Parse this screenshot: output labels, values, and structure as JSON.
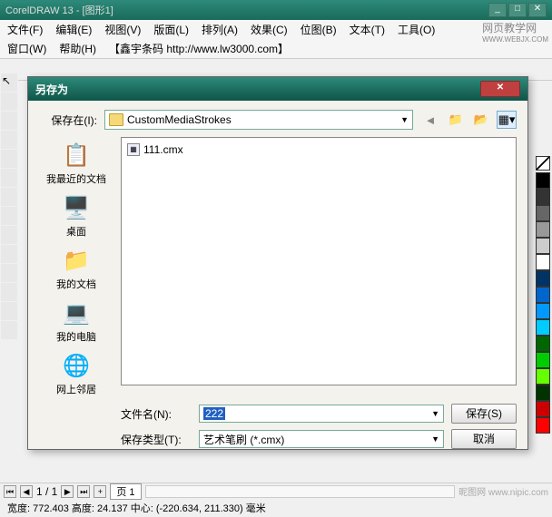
{
  "app": {
    "title": "CorelDRAW 13 - [图形1]",
    "watermark": "网页教学网",
    "watermark_url": "WWW.WEBJX.COM"
  },
  "menu": {
    "items": [
      "文件(F)",
      "编辑(E)",
      "视图(V)",
      "版面(L)",
      "排列(A)",
      "效果(C)",
      "位图(B)",
      "文本(T)",
      "工具(O)"
    ],
    "row2": [
      "窗口(W)",
      "帮助(H)"
    ],
    "extra": "【鑫宇条码 http://www.lw3000.com】"
  },
  "dialog": {
    "title": "另存为",
    "close_x": "✕",
    "save_in_label": "保存在(I):",
    "folder_name": "CustomMediaStrokes",
    "places": [
      {
        "icon": "📄",
        "label": "我最近的文档"
      },
      {
        "icon": "🖥️",
        "label": "桌面"
      },
      {
        "icon": "📁",
        "label": "我的文档"
      },
      {
        "icon": "💻",
        "label": "我的电脑"
      },
      {
        "icon": "🌐",
        "label": "网上邻居"
      }
    ],
    "file_item": "111.cmx",
    "filename_label": "文件名(N):",
    "filename_value": "222",
    "filetype_label": "保存类型(T):",
    "filetype_value": "艺术笔刷 (*.cmx)",
    "save_btn": "保存(S)",
    "cancel_btn": "取消"
  },
  "palette_colors": [
    "#000000",
    "#ffffff",
    "#0099ff",
    "#993333",
    "#cc00cc",
    "#ff6600",
    "#ffcc00",
    "#00cc00",
    "#0066ff",
    "#0033cc",
    "#006633",
    "#999999"
  ],
  "nav": {
    "page_info": "1 / 1",
    "page_tab": "页 1"
  },
  "status": {
    "text": "宽度: 772.403 高度: 24.137 中心: (-220.634, 211.330) 毫米"
  },
  "bottom_watermark": "昵图网 www.nipic.com"
}
